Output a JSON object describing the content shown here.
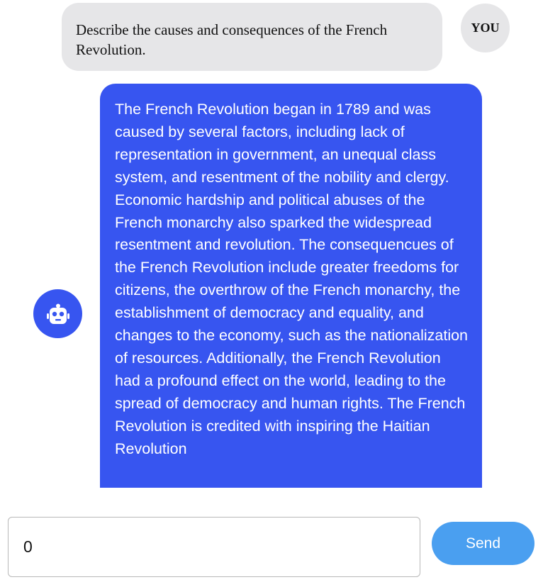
{
  "conversation": {
    "user_message": {
      "author_label": "YOU",
      "text": "Describe the causes and consequences of the French Revolution."
    },
    "bot_message": {
      "avatar_icon": "robot-icon",
      "text": "The French Revolution began in 1789 and was caused by several factors, including lack of representation in government, an unequal class system, and resentment of the nobility and clergy. Economic hardship and political abuses of the French monarchy also sparked the widespread resentment and revolution. The consequencues of the French Revolution include greater freedoms for citizens, the overthrow of the French monarchy, the establishment of democracy and equality, and changes to the economy, such as the nationalization of resources. Additionally, the French Revolution had a profound effect on the world, leading to the spread of democracy and human rights. The French Revolution is credited with inspiring the Haitian Revolution"
    }
  },
  "composer": {
    "input_value": "0",
    "send_label": "Send"
  },
  "colors": {
    "bot_bubble": "#3755f0",
    "user_bubble": "#e6e6e8",
    "send_button": "#4a9ff0"
  }
}
